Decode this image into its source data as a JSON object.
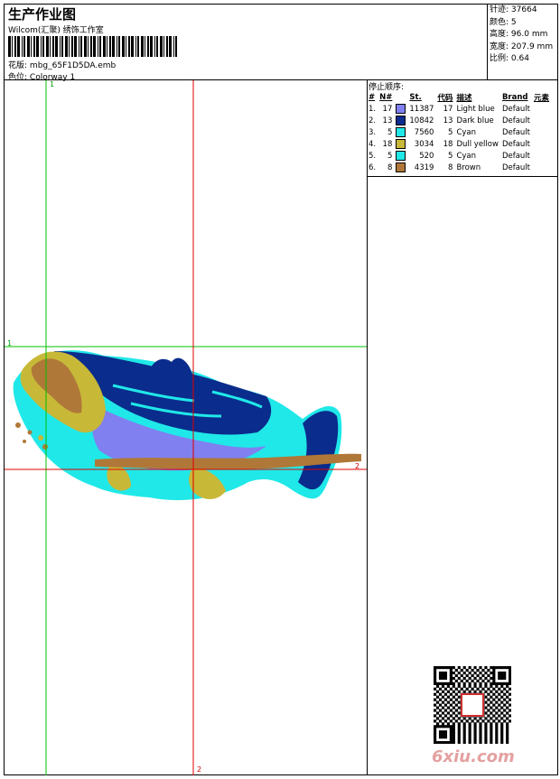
{
  "header": {
    "title": "生产作业图",
    "company": "Wilcom(汇聚) 绣饰工作室",
    "file_label": "花版:",
    "file_name": "mbg_65F1D5DA.emb",
    "colorway_label": "色位:",
    "colorway": "Colorway 1"
  },
  "stats": [
    {
      "label": "针迹:",
      "value": "37664"
    },
    {
      "label": "颜色:",
      "value": "5"
    },
    {
      "label": "高度:",
      "value": "96.0 mm"
    },
    {
      "label": "宽度:",
      "value": "207.9 mm"
    },
    {
      "label": "比例:",
      "value": "0.64"
    }
  ],
  "stop_sequence": {
    "title": "停止顺序:",
    "headers": [
      "#",
      "N#",
      "St.",
      "代码",
      "描述",
      "Brand",
      "元素"
    ],
    "rows": [
      {
        "idx": "1.",
        "n": "17",
        "color": "#8080f0",
        "st": "11387",
        "code": "17",
        "desc": "Light blue",
        "brand": "Default"
      },
      {
        "idx": "2.",
        "n": "13",
        "color": "#0a2c8c",
        "st": "10842",
        "code": "13",
        "desc": "Dark blue",
        "brand": "Default"
      },
      {
        "idx": "3.",
        "n": "5",
        "color": "#20e8e8",
        "st": "7560",
        "code": "5",
        "desc": "Cyan",
        "brand": "Default"
      },
      {
        "idx": "4.",
        "n": "18",
        "color": "#c8b838",
        "st": "3034",
        "code": "18",
        "desc": "Dull yellow",
        "brand": "Default"
      },
      {
        "idx": "5.",
        "n": "5",
        "color": "#20e8e8",
        "st": "520",
        "code": "5",
        "desc": "Cyan",
        "brand": "Default"
      },
      {
        "idx": "6.",
        "n": "8",
        "color": "#b07838",
        "st": "4319",
        "code": "8",
        "desc": "Brown",
        "brand": "Default"
      }
    ]
  },
  "guides": {
    "green": "1",
    "red": "2"
  },
  "watermark": "6xiu.com",
  "colors": {
    "light_blue": "#8080f0",
    "dark_blue": "#0a2c8c",
    "cyan": "#20e8e8",
    "dull_yellow": "#c8b838",
    "brown": "#b07838",
    "guide_green": "#00c000",
    "guide_red": "#e00000"
  }
}
